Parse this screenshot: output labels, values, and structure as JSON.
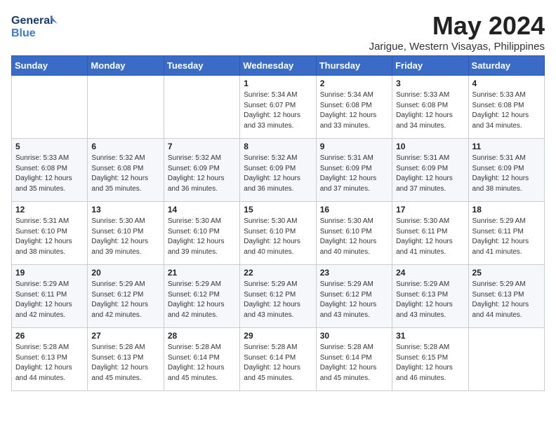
{
  "header": {
    "logo_line1": "General",
    "logo_line2": "Blue",
    "title": "May 2024",
    "location": "Jarigue, Western Visayas, Philippines"
  },
  "columns": [
    "Sunday",
    "Monday",
    "Tuesday",
    "Wednesday",
    "Thursday",
    "Friday",
    "Saturday"
  ],
  "weeks": [
    [
      {
        "day": "",
        "info": ""
      },
      {
        "day": "",
        "info": ""
      },
      {
        "day": "",
        "info": ""
      },
      {
        "day": "1",
        "info": "Sunrise: 5:34 AM\nSunset: 6:07 PM\nDaylight: 12 hours\nand 33 minutes."
      },
      {
        "day": "2",
        "info": "Sunrise: 5:34 AM\nSunset: 6:08 PM\nDaylight: 12 hours\nand 33 minutes."
      },
      {
        "day": "3",
        "info": "Sunrise: 5:33 AM\nSunset: 6:08 PM\nDaylight: 12 hours\nand 34 minutes."
      },
      {
        "day": "4",
        "info": "Sunrise: 5:33 AM\nSunset: 6:08 PM\nDaylight: 12 hours\nand 34 minutes."
      }
    ],
    [
      {
        "day": "5",
        "info": "Sunrise: 5:33 AM\nSunset: 6:08 PM\nDaylight: 12 hours\nand 35 minutes."
      },
      {
        "day": "6",
        "info": "Sunrise: 5:32 AM\nSunset: 6:08 PM\nDaylight: 12 hours\nand 35 minutes."
      },
      {
        "day": "7",
        "info": "Sunrise: 5:32 AM\nSunset: 6:09 PM\nDaylight: 12 hours\nand 36 minutes."
      },
      {
        "day": "8",
        "info": "Sunrise: 5:32 AM\nSunset: 6:09 PM\nDaylight: 12 hours\nand 36 minutes."
      },
      {
        "day": "9",
        "info": "Sunrise: 5:31 AM\nSunset: 6:09 PM\nDaylight: 12 hours\nand 37 minutes."
      },
      {
        "day": "10",
        "info": "Sunrise: 5:31 AM\nSunset: 6:09 PM\nDaylight: 12 hours\nand 37 minutes."
      },
      {
        "day": "11",
        "info": "Sunrise: 5:31 AM\nSunset: 6:09 PM\nDaylight: 12 hours\nand 38 minutes."
      }
    ],
    [
      {
        "day": "12",
        "info": "Sunrise: 5:31 AM\nSunset: 6:10 PM\nDaylight: 12 hours\nand 38 minutes."
      },
      {
        "day": "13",
        "info": "Sunrise: 5:30 AM\nSunset: 6:10 PM\nDaylight: 12 hours\nand 39 minutes."
      },
      {
        "day": "14",
        "info": "Sunrise: 5:30 AM\nSunset: 6:10 PM\nDaylight: 12 hours\nand 39 minutes."
      },
      {
        "day": "15",
        "info": "Sunrise: 5:30 AM\nSunset: 6:10 PM\nDaylight: 12 hours\nand 40 minutes."
      },
      {
        "day": "16",
        "info": "Sunrise: 5:30 AM\nSunset: 6:10 PM\nDaylight: 12 hours\nand 40 minutes."
      },
      {
        "day": "17",
        "info": "Sunrise: 5:30 AM\nSunset: 6:11 PM\nDaylight: 12 hours\nand 41 minutes."
      },
      {
        "day": "18",
        "info": "Sunrise: 5:29 AM\nSunset: 6:11 PM\nDaylight: 12 hours\nand 41 minutes."
      }
    ],
    [
      {
        "day": "19",
        "info": "Sunrise: 5:29 AM\nSunset: 6:11 PM\nDaylight: 12 hours\nand 42 minutes."
      },
      {
        "day": "20",
        "info": "Sunrise: 5:29 AM\nSunset: 6:12 PM\nDaylight: 12 hours\nand 42 minutes."
      },
      {
        "day": "21",
        "info": "Sunrise: 5:29 AM\nSunset: 6:12 PM\nDaylight: 12 hours\nand 42 minutes."
      },
      {
        "day": "22",
        "info": "Sunrise: 5:29 AM\nSunset: 6:12 PM\nDaylight: 12 hours\nand 43 minutes."
      },
      {
        "day": "23",
        "info": "Sunrise: 5:29 AM\nSunset: 6:12 PM\nDaylight: 12 hours\nand 43 minutes."
      },
      {
        "day": "24",
        "info": "Sunrise: 5:29 AM\nSunset: 6:13 PM\nDaylight: 12 hours\nand 43 minutes."
      },
      {
        "day": "25",
        "info": "Sunrise: 5:29 AM\nSunset: 6:13 PM\nDaylight: 12 hours\nand 44 minutes."
      }
    ],
    [
      {
        "day": "26",
        "info": "Sunrise: 5:28 AM\nSunset: 6:13 PM\nDaylight: 12 hours\nand 44 minutes."
      },
      {
        "day": "27",
        "info": "Sunrise: 5:28 AM\nSunset: 6:13 PM\nDaylight: 12 hours\nand 45 minutes."
      },
      {
        "day": "28",
        "info": "Sunrise: 5:28 AM\nSunset: 6:14 PM\nDaylight: 12 hours\nand 45 minutes."
      },
      {
        "day": "29",
        "info": "Sunrise: 5:28 AM\nSunset: 6:14 PM\nDaylight: 12 hours\nand 45 minutes."
      },
      {
        "day": "30",
        "info": "Sunrise: 5:28 AM\nSunset: 6:14 PM\nDaylight: 12 hours\nand 45 minutes."
      },
      {
        "day": "31",
        "info": "Sunrise: 5:28 AM\nSunset: 6:15 PM\nDaylight: 12 hours\nand 46 minutes."
      },
      {
        "day": "",
        "info": ""
      }
    ]
  ]
}
